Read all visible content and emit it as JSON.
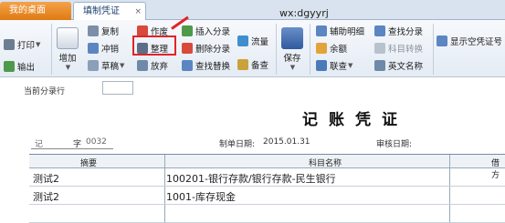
{
  "tabs": [
    {
      "label": "我的桌面"
    },
    {
      "label": "填制凭证",
      "close": "×"
    }
  ],
  "ribbon": {
    "print": "打印",
    "output": "输出",
    "add": "增加",
    "copy": "复制",
    "reverse": "冲销",
    "draft": "草稿",
    "void": "作废",
    "organize": "整理",
    "abandon": "放弃",
    "insert_entry": "插入分录",
    "delete_entry": "删除分录",
    "find_replace": "查找替换",
    "flow": "流量",
    "memo": "备查",
    "save": "保存",
    "aux_detail": "辅助明细",
    "balance": "余额",
    "linked_query": "联查",
    "find_entry": "查找分录",
    "subject_convert": "科目转换",
    "english_name": "英文名称",
    "show_empty_voucher_no": "显示空凭证号"
  },
  "watermark": "wx:dgyyrj",
  "voucher": {
    "current_entry_label": "当前分录行",
    "title": "记账凭证",
    "type_label": "记",
    "number_label": "字",
    "number_value": "0032",
    "date_label": "制单日期:",
    "date_value": "2015.01.31",
    "audit_label": "审核日期:",
    "columns": {
      "summary": "摘要",
      "subject": "科目名称",
      "debit": "借方"
    },
    "rows": [
      {
        "summary": "测试2",
        "subject": "100201-银行存款/银行存款-民生银行"
      },
      {
        "summary": "测试2",
        "subject": "1001-库存现金"
      }
    ]
  },
  "colors": {
    "accent": "#e07a12",
    "highlight": "#e0242a",
    "ribbon_bg": "#e4ebf4"
  }
}
